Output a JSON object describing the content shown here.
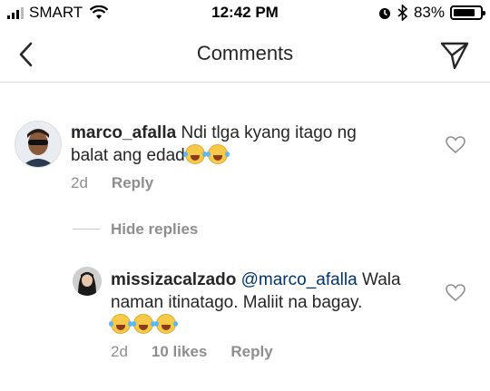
{
  "status_bar": {
    "carrier": "SMART",
    "time": "12:42 PM",
    "battery": "83%",
    "battery_level": 0.83
  },
  "header": {
    "title": "Comments"
  },
  "comments": [
    {
      "username": "marco_afalla",
      "text": "Ndi tlga kyang itago ng balat ang edad",
      "emoji_count": 2,
      "age": "2d",
      "reply_label": "Reply"
    }
  ],
  "replies_toggle": "Hide replies",
  "replies": [
    {
      "username": "missizacalzado",
      "mention": "@marco_afalla",
      "text": "Wala naman itinatago. Maliit na bagay.",
      "emoji_count": 3,
      "age": "2d",
      "likes": "10 likes",
      "reply_label": "Reply"
    }
  ],
  "colors": {
    "text": "#262626",
    "secondary": "#8e8e8e",
    "mention": "#003569",
    "divider": "#dbdbdb"
  }
}
